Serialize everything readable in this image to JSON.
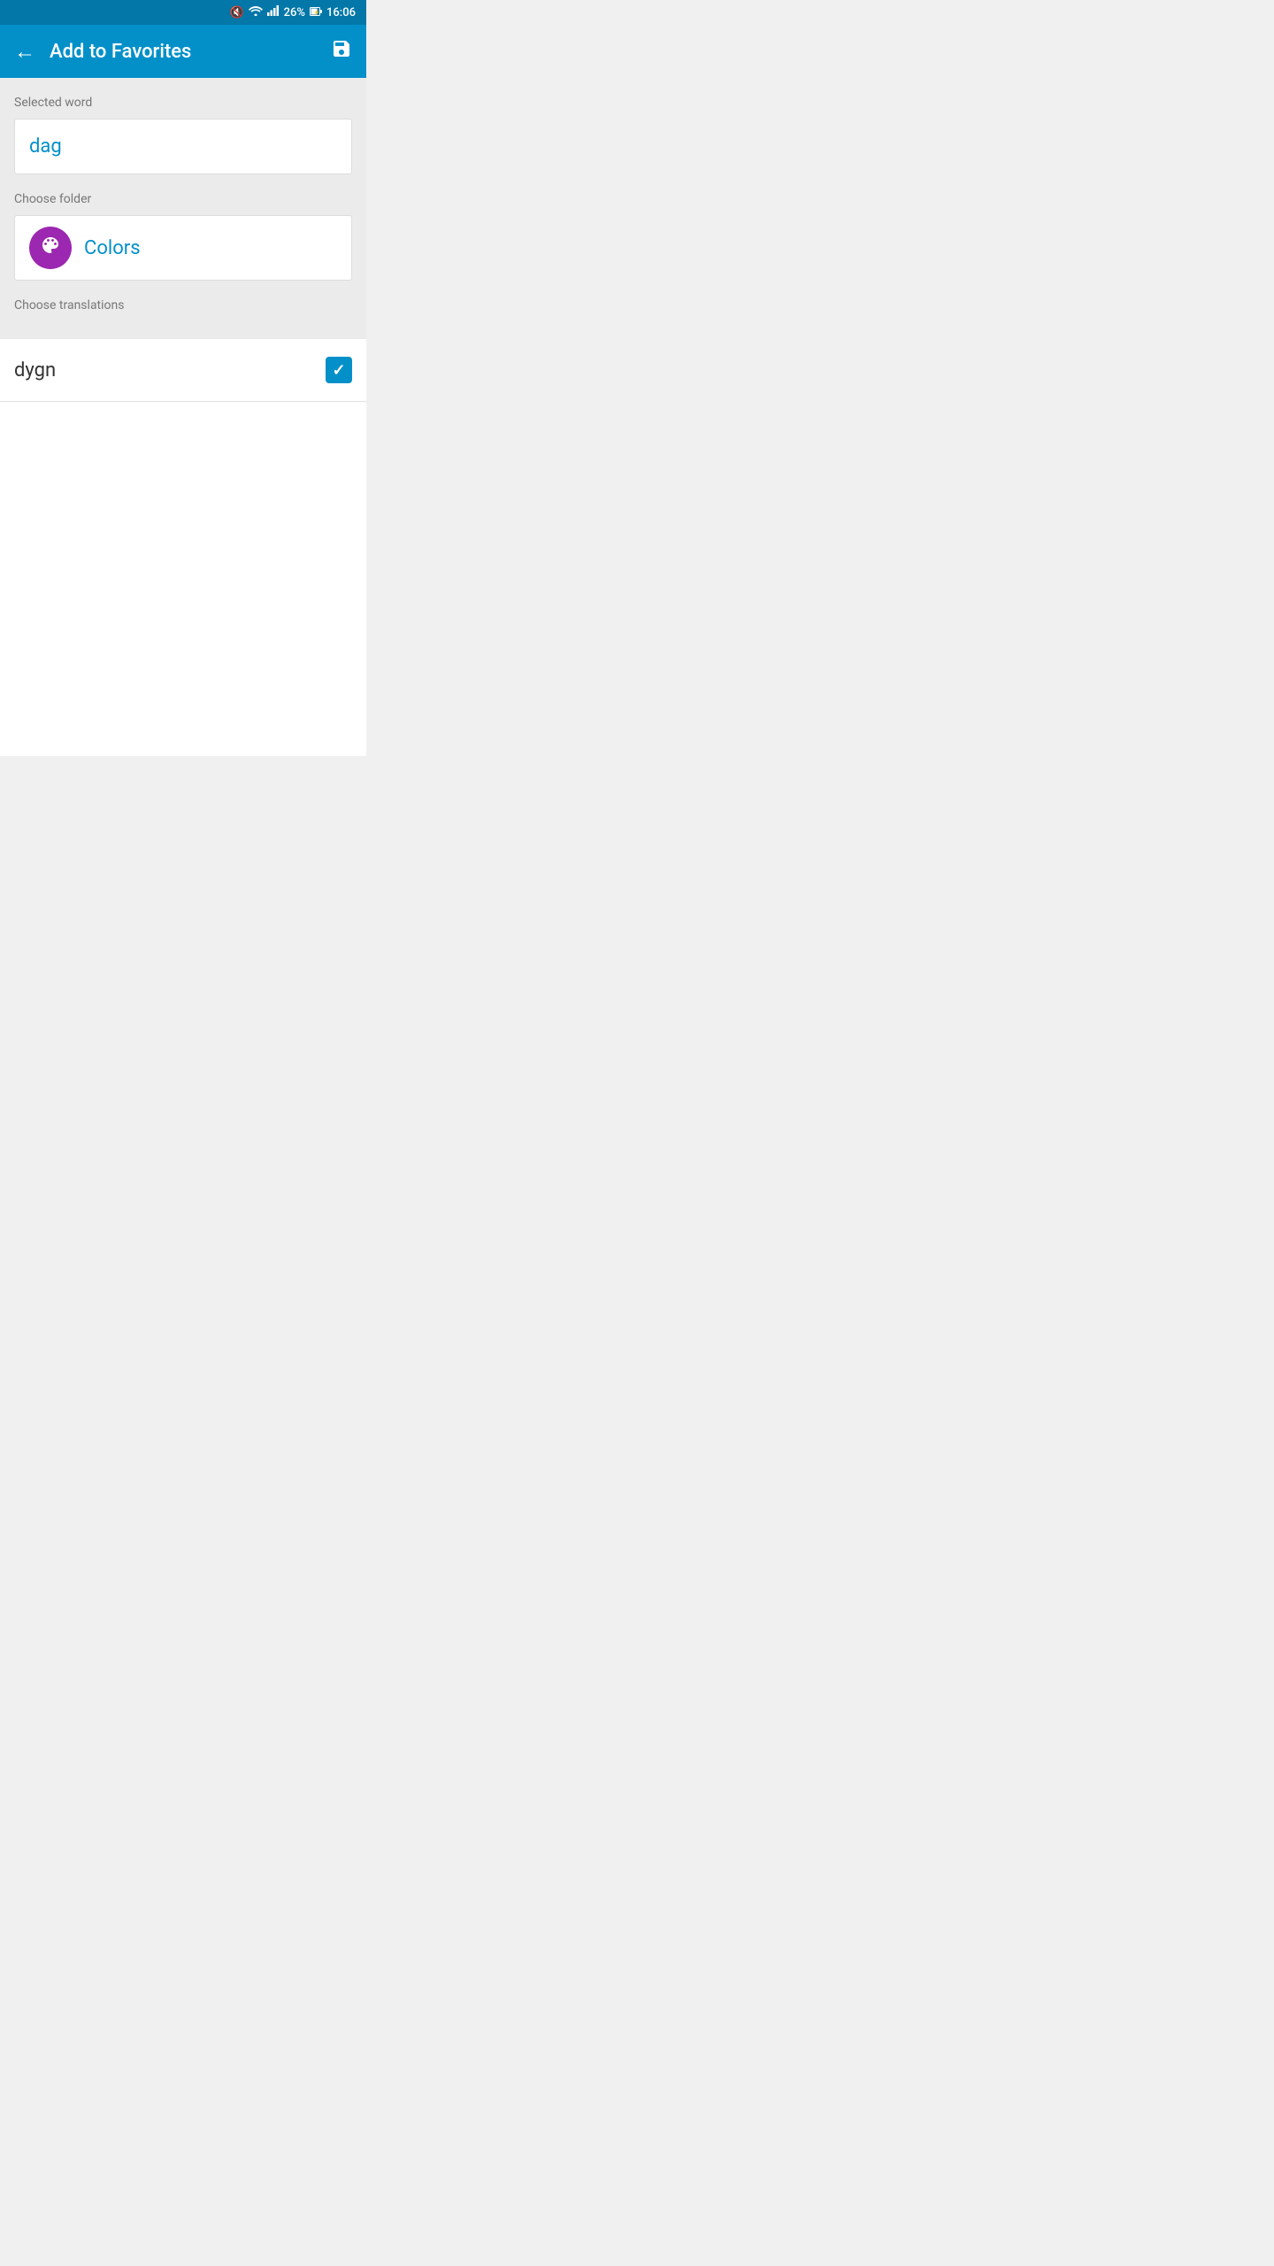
{
  "statusBar": {
    "battery": "26%",
    "time": "16:06",
    "muteIcon": "🔇",
    "wifiIcon": "wifi",
    "signalIcon": "signal",
    "batteryIcon": "battery"
  },
  "appBar": {
    "title": "Add to Favorites",
    "backIcon": "←",
    "saveIcon": "💾"
  },
  "selectedWord": {
    "label": "Selected word",
    "value": "dag"
  },
  "chooseFolder": {
    "label": "Choose folder",
    "folderName": "Colors"
  },
  "chooseTranslations": {
    "label": "Choose translations"
  },
  "translations": [
    {
      "word": "dygn",
      "checked": true
    }
  ]
}
